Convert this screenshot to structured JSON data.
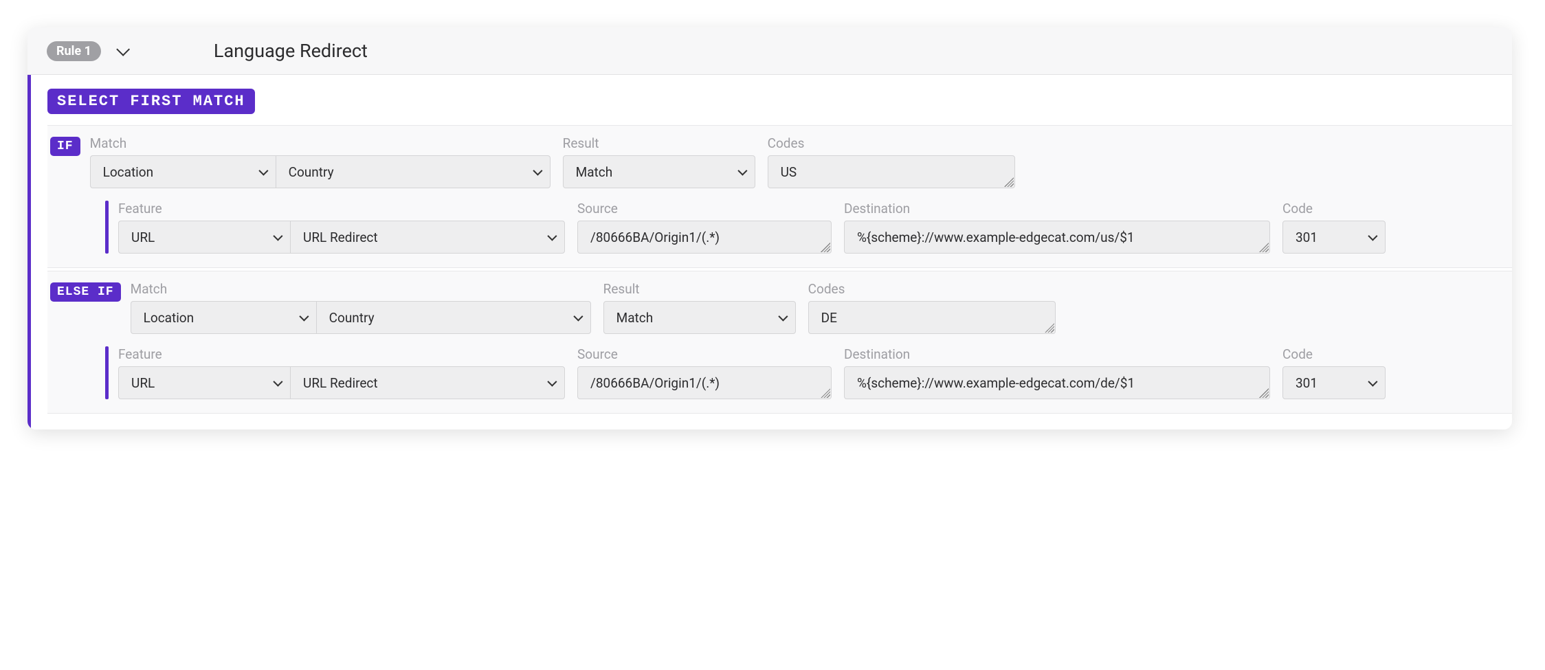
{
  "header": {
    "rule_badge": "Rule 1",
    "title": "Language Redirect"
  },
  "section_tag": "SELECT FIRST MATCH",
  "labels": {
    "match": "Match",
    "result": "Result",
    "codes": "Codes",
    "feature": "Feature",
    "source": "Source",
    "destination": "Destination",
    "code": "Code"
  },
  "blocks": [
    {
      "chip": "IF",
      "match_category": "Location",
      "match_sub": "Country",
      "result": "Match",
      "codes": "US",
      "feature_category": "URL",
      "feature_sub": "URL Redirect",
      "source": "/80666BA/Origin1/(.*)",
      "destination": "%{scheme}://www.example-edgecat.com/us/$1",
      "code": "301"
    },
    {
      "chip": "ELSE IF",
      "match_category": "Location",
      "match_sub": "Country",
      "result": "Match",
      "codes": "DE",
      "feature_category": "URL",
      "feature_sub": "URL Redirect",
      "source": "/80666BA/Origin1/(.*)",
      "destination": "%{scheme}://www.example-edgecat.com/de/$1",
      "code": "301"
    }
  ]
}
